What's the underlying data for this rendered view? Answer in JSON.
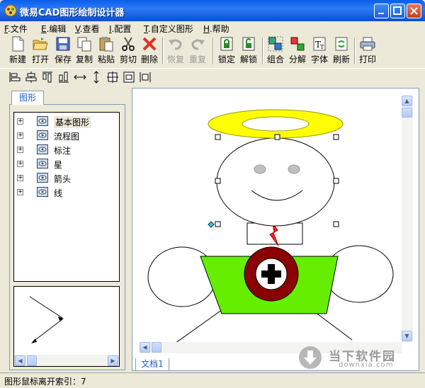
{
  "window": {
    "title": "微易CAD图形绘制设计器"
  },
  "menu": [
    {
      "key": "F",
      "label": ".文件"
    },
    {
      "key": "E",
      "label": ".编辑"
    },
    {
      "key": "V",
      "label": ".查看"
    },
    {
      "key": "I",
      "label": ".配置"
    },
    {
      "key": "T",
      "label": ".自定义图形"
    },
    {
      "key": "H",
      "label": ".帮助"
    }
  ],
  "toolbar": {
    "new": "新建",
    "open": "打开",
    "save": "保存",
    "copy": "复制",
    "paste": "粘贴",
    "cut": "剪切",
    "delete": "删除",
    "undo": "恢复",
    "redo": "重复",
    "lock": "锁定",
    "unlock": "解锁",
    "group": "组合",
    "ungroup": "分解",
    "font": "字体",
    "refresh": "刷新",
    "print": "打印"
  },
  "left_panel": {
    "tab": "图形",
    "tree": [
      "基本图形",
      "流程图",
      "标注",
      "星",
      "箭头",
      "线"
    ]
  },
  "document_tab": "文档1",
  "status": "图形鼠标离开索引：7",
  "watermark": {
    "text": "当下软件园",
    "url": "downxia.com"
  },
  "colors": {
    "halo": "#ffff00",
    "body": "#66ee00",
    "badge_outer": "#8b0000",
    "tie": "#ff0000",
    "handle_cyan": "#33cccc"
  }
}
